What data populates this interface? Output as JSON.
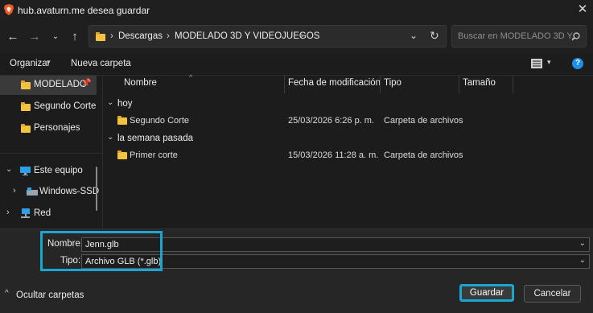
{
  "window": {
    "title": "hub.avaturn.me desea guardar"
  },
  "nav": {
    "breadcrumbs": [
      "Descargas",
      "MODELADO 3D Y VIDEOJUEGOS"
    ],
    "search_placeholder": "Buscar en MODELADO 3D Y..."
  },
  "toolbar": {
    "organize_label": "Organizar",
    "new_folder_label": "Nueva carpeta"
  },
  "sidebar": {
    "items": [
      {
        "label": "MODELADO",
        "icon": "folder-icon",
        "pinned": true
      },
      {
        "label": "Segundo Corte",
        "icon": "folder-icon"
      },
      {
        "label": "Personajes",
        "icon": "folder-icon"
      },
      {
        "label": "Este equipo",
        "icon": "computer-icon"
      },
      {
        "label": "Windows-SSD",
        "icon": "drive-icon"
      },
      {
        "label": "Red",
        "icon": "network-icon"
      }
    ]
  },
  "columns": [
    "Nombre",
    "Fecha de modificación",
    "Tipo",
    "Tamaño"
  ],
  "groups": [
    {
      "label": "hoy",
      "rows": [
        {
          "name": "Segundo Corte",
          "date": "25/03/2026 6:26 p. m.",
          "type": "Carpeta de archivos"
        }
      ]
    },
    {
      "label": "la semana pasada",
      "rows": [
        {
          "name": "Primer corte",
          "date": "15/03/2026 11:28 a. m.",
          "type": "Carpeta de archivos"
        }
      ]
    }
  ],
  "save": {
    "name_label": "Nombre:",
    "name_value": "Jenn.glb",
    "type_label": "Tipo:",
    "type_value": "Archivo GLB (*.glb)",
    "hide_folders_label": "Ocultar carpetas",
    "save_button": "Guardar",
    "cancel_button": "Cancelar"
  },
  "colors": {
    "accent_highlight": "#19a7cf",
    "folder": "#f3c23f",
    "help": "#1e8fe6"
  }
}
